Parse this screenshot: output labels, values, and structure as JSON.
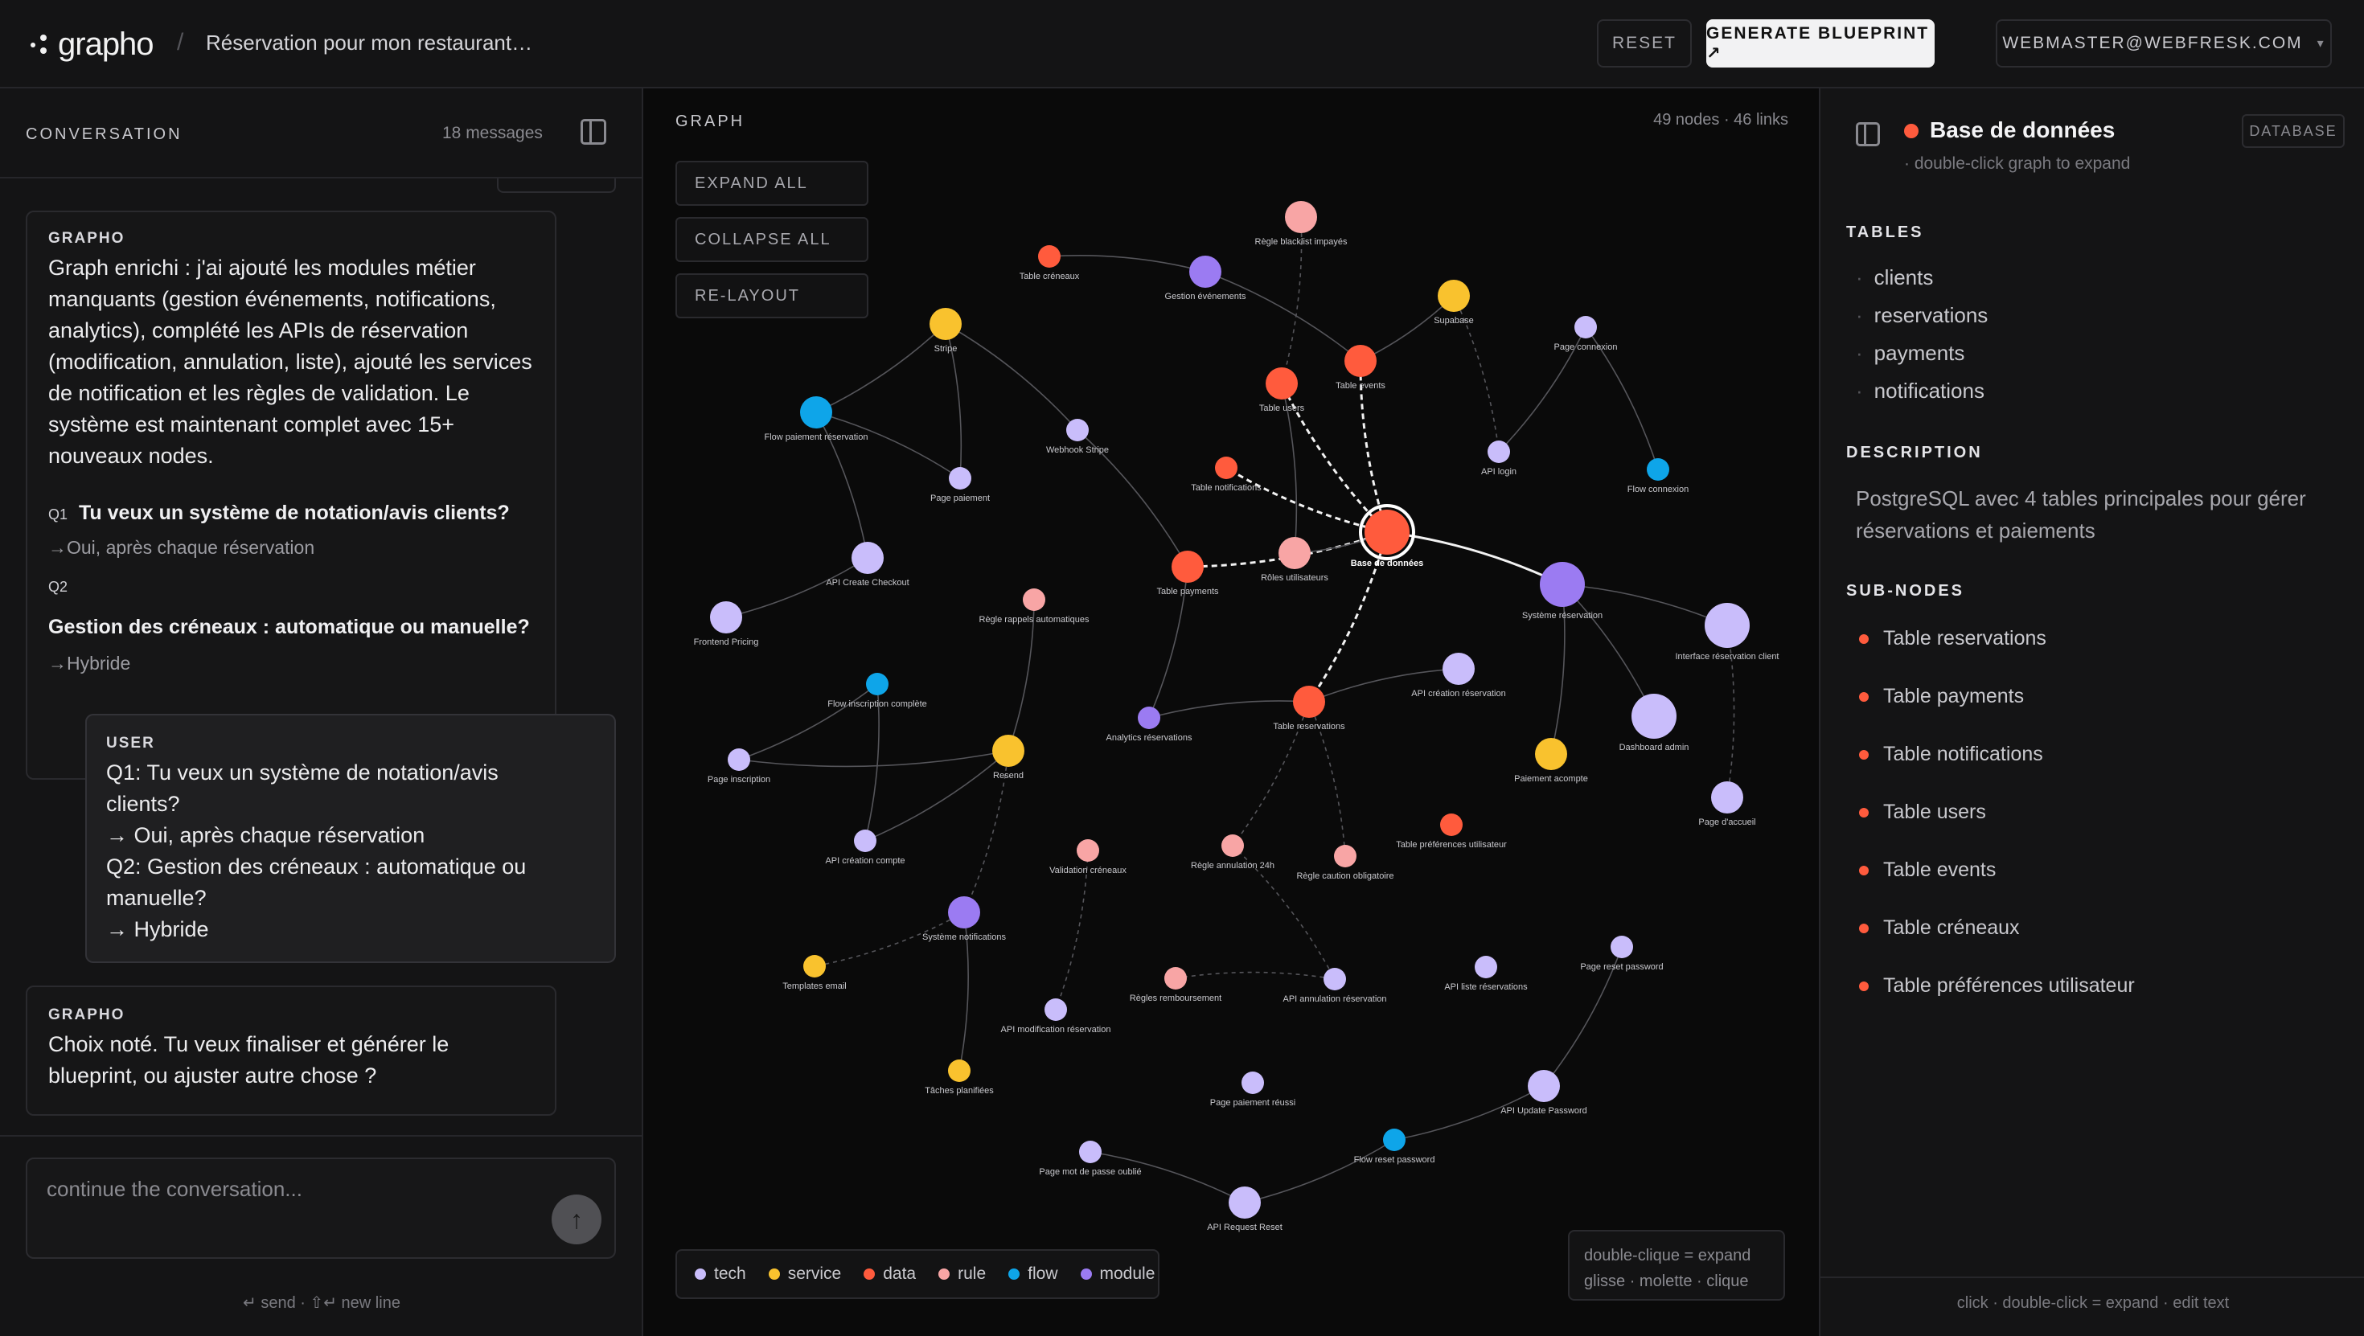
{
  "header": {
    "logo_text": "grapho",
    "crumb_separator": "/",
    "project_title": "Réservation pour mon restaurant…",
    "reset_label": "RESET",
    "generate_label": "GENERATE BLUEPRINT ↗",
    "user_email": "WEBMASTER@WEBFRESK.COM"
  },
  "conversation": {
    "title": "CONVERSATION",
    "count": "18 messages",
    "m1": {
      "author": "GRAPHO",
      "text": "Graph enrichi : j'ai ajouté les modules métier manquants (gestion événements, notifications, analytics), complété les APIs de réservation (modification, annulation, liste), ajouté les services de notification et les règles de validation. Le système est maintenant complet avec 15+ nouveaux nodes.",
      "q1_label": "Q1",
      "q1": "Tu veux un système de notation/avis clients?",
      "a1": "→Oui, après chaque réservation",
      "q2_label": "Q2",
      "q2": "Gestion des créneaux : automatique ou manuelle?",
      "a2": "→Hybride"
    },
    "m2": {
      "author": "USER",
      "l1": "Q1: Tu veux un système de notation/avis",
      "l2": "clients?",
      "l3": "→ Oui, après chaque réservation",
      "l4": "Q2: Gestion des créneaux : automatique ou",
      "l5": "manuelle?",
      "l6": "→ Hybride"
    },
    "m3": {
      "author": "GRAPHO",
      "text": "Choix noté. Tu veux finaliser et générer le blueprint, ou ajuster autre chose ?"
    },
    "input_placeholder": "continue the conversation...",
    "send_icon": "↑",
    "hint": "↵ send · ⇧↵ new line"
  },
  "graph": {
    "title": "GRAPH",
    "stats": "49 nodes · 46 links",
    "expand_all": "EXPAND ALL",
    "collapse_all": "COLLAPSE ALL",
    "relayout": "RE-LAYOUT",
    "hint_line1": "double-clique = expand",
    "hint_line2": "glisse · molette · clique",
    "legend": [
      {
        "label": "tech",
        "color": "#c9bdfb"
      },
      {
        "label": "service",
        "color": "#f9c22e"
      },
      {
        "label": "data",
        "color": "#ff5b3d"
      },
      {
        "label": "rule",
        "color": "#f8a5a5"
      },
      {
        "label": "flow",
        "color": "#0ea5e9"
      },
      {
        "label": "module",
        "color": "#9b7bf2"
      }
    ],
    "nodes": [
      {
        "id": "db",
        "label": "Base de données",
        "type": "data",
        "size": "lg",
        "selected": true
      },
      {
        "id": "systeme",
        "label": "Système réservation",
        "type": "module",
        "size": "lg"
      },
      {
        "id": "tresv",
        "label": "Table reservations",
        "type": "data",
        "size": "md"
      },
      {
        "id": "tpay",
        "label": "Table payments",
        "type": "data",
        "size": "md"
      },
      {
        "id": "tnotif",
        "label": "Table notifications",
        "type": "data",
        "size": "sm"
      },
      {
        "id": "tusers",
        "label": "Table users",
        "type": "data",
        "size": "md"
      },
      {
        "id": "tevents",
        "label": "Table events",
        "type": "data",
        "size": "md"
      },
      {
        "id": "tcren",
        "label": "Table créneaux",
        "type": "data",
        "size": "sm"
      },
      {
        "id": "tpref",
        "label": "Table préférences utilisateur",
        "type": "data",
        "size": "sm"
      },
      {
        "id": "roles",
        "label": "Rôles utilisateurs",
        "type": "rule",
        "size": "md"
      },
      {
        "id": "blacklist",
        "label": "Règle blacklist impayés",
        "type": "rule",
        "size": "md"
      },
      {
        "id": "gestev",
        "label": "Gestion événements",
        "type": "module",
        "size": "md"
      },
      {
        "id": "supabase",
        "label": "Supabase",
        "type": "service",
        "size": "md"
      },
      {
        "id": "stripe",
        "label": "Stripe",
        "type": "service",
        "size": "md"
      },
      {
        "id": "flowpay",
        "label": "Flow paiement réservation",
        "type": "flow",
        "size": "md"
      },
      {
        "id": "pagepay",
        "label": "Page paiement",
        "type": "tech",
        "size": "sm"
      },
      {
        "id": "webhook",
        "label": "Webhook Stripe",
        "type": "tech",
        "size": "sm"
      },
      {
        "id": "pageconn",
        "label": "Page connexion",
        "type": "tech",
        "size": "sm"
      },
      {
        "id": "apilogin",
        "label": "API login",
        "type": "tech",
        "size": "sm"
      },
      {
        "id": "flowconn",
        "label": "Flow connexion",
        "type": "flow",
        "size": "sm"
      },
      {
        "id": "apicheckout",
        "label": "API Create Checkout",
        "type": "tech",
        "size": "md"
      },
      {
        "id": "frontpricing",
        "label": "Frontend Pricing",
        "type": "tech",
        "size": "md"
      },
      {
        "id": "rappels",
        "label": "Règle rappels automatiques",
        "type": "rule",
        "size": "sm"
      },
      {
        "id": "flowinscr",
        "label": "Flow inscription complète",
        "type": "flow",
        "size": "sm"
      },
      {
        "id": "pageinscr",
        "label": "Page inscription",
        "type": "tech",
        "size": "sm"
      },
      {
        "id": "resend",
        "label": "Resend",
        "type": "service",
        "size": "md"
      },
      {
        "id": "apicompte",
        "label": "API création compte",
        "type": "tech",
        "size": "sm"
      },
      {
        "id": "analytics",
        "label": "Analytics réservations",
        "type": "module",
        "size": "sm"
      },
      {
        "id": "apicreres",
        "label": "API création réservation",
        "type": "tech",
        "size": "md"
      },
      {
        "id": "interface",
        "label": "Interface réservation client",
        "type": "tech",
        "size": "lg"
      },
      {
        "id": "dashboard",
        "label": "Dashboard admin",
        "type": "tech",
        "size": "lg"
      },
      {
        "id": "acompte",
        "label": "Paiement acompte",
        "type": "service",
        "size": "md"
      },
      {
        "id": "accueil",
        "label": "Page d'accueil",
        "type": "tech",
        "size": "md"
      },
      {
        "id": "validcren",
        "label": "Validation créneaux",
        "type": "rule",
        "size": "sm"
      },
      {
        "id": "annul24",
        "label": "Règle annulation 24h",
        "type": "rule",
        "size": "sm"
      },
      {
        "id": "caution",
        "label": "Règle caution obligatoire",
        "type": "rule",
        "size": "sm"
      },
      {
        "id": "sysnotif",
        "label": "Système notifications",
        "type": "module",
        "size": "md"
      },
      {
        "id": "templates",
        "label": "Templates email",
        "type": "service",
        "size": "sm"
      },
      {
        "id": "taches",
        "label": "Tâches planifiées",
        "type": "service",
        "size": "sm"
      },
      {
        "id": "apimodif",
        "label": "API modification réservation",
        "type": "tech",
        "size": "sm"
      },
      {
        "id": "rembours",
        "label": "Règles remboursement",
        "type": "rule",
        "size": "sm"
      },
      {
        "id": "apiannul",
        "label": "API annulation réservation",
        "type": "tech",
        "size": "sm"
      },
      {
        "id": "apiliste",
        "label": "API liste réservations",
        "type": "tech",
        "size": "sm"
      },
      {
        "id": "pagereset",
        "label": "Page reset password",
        "type": "tech",
        "size": "sm"
      },
      {
        "id": "apiupdate",
        "label": "API Update Password",
        "type": "tech",
        "size": "md"
      },
      {
        "id": "pagereussi",
        "label": "Page paiement réussi",
        "type": "tech",
        "size": "sm"
      },
      {
        "id": "flowreset",
        "label": "Flow reset password",
        "type": "flow",
        "size": "sm"
      },
      {
        "id": "pagemdp",
        "label": "Page mot de passe oublié",
        "type": "tech",
        "size": "sm"
      },
      {
        "id": "apireqreset",
        "label": "API Request Reset",
        "type": "tech",
        "size": "md"
      }
    ],
    "links": [
      {
        "s": "db",
        "t": "systeme",
        "style": "solid-bold"
      },
      {
        "s": "db",
        "t": "tresv",
        "style": "dash-bold"
      },
      {
        "s": "db",
        "t": "tpay",
        "style": "dash-bold"
      },
      {
        "s": "db",
        "t": "tnotif",
        "style": "dash-bold"
      },
      {
        "s": "db",
        "t": "tusers",
        "style": "dash-bold"
      },
      {
        "s": "db",
        "t": "tevents",
        "style": "dash-bold"
      },
      {
        "s": "db",
        "t": "roles",
        "style": "solid"
      },
      {
        "s": "systeme",
        "t": "interface",
        "style": "solid"
      },
      {
        "s": "systeme",
        "t": "dashboard",
        "style": "solid"
      },
      {
        "s": "systeme",
        "t": "acompte",
        "style": "solid"
      },
      {
        "s": "interface",
        "t": "accueil",
        "style": "dash"
      },
      {
        "s": "tcren",
        "t": "gestev",
        "style": "solid"
      },
      {
        "s": "gestev",
        "t": "tevents",
        "style": "solid"
      },
      {
        "s": "supabase",
        "t": "tevents",
        "style": "solid"
      },
      {
        "s": "supabase",
        "t": "apilogin",
        "style": "dash"
      },
      {
        "s": "pageconn",
        "t": "apilogin",
        "style": "solid"
      },
      {
        "s": "pageconn",
        "t": "flowconn",
        "style": "solid"
      },
      {
        "s": "blacklist",
        "t": "tusers",
        "style": "dash"
      },
      {
        "s": "stripe",
        "t": "flowpay",
        "style": "solid"
      },
      {
        "s": "stripe",
        "t": "pagepay",
        "style": "solid"
      },
      {
        "s": "stripe",
        "t": "webhook",
        "style": "solid"
      },
      {
        "s": "flowpay",
        "t": "pagepay",
        "style": "solid"
      },
      {
        "s": "flowpay",
        "t": "apicheckout",
        "style": "solid"
      },
      {
        "s": "webhook",
        "t": "tpay",
        "style": "solid"
      },
      {
        "s": "apicheckout",
        "t": "frontpricing",
        "style": "solid"
      },
      {
        "s": "tpay",
        "t": "analytics",
        "style": "solid"
      },
      {
        "s": "analytics",
        "t": "tresv",
        "style": "solid"
      },
      {
        "s": "tresv",
        "t": "apicreres",
        "style": "solid"
      },
      {
        "s": "tresv",
        "t": "annul24",
        "style": "dash"
      },
      {
        "s": "tresv",
        "t": "caution",
        "style": "dash"
      },
      {
        "s": "rappels",
        "t": "resend",
        "style": "solid"
      },
      {
        "s": "resend",
        "t": "pageinscr",
        "style": "solid"
      },
      {
        "s": "resend",
        "t": "apicompte",
        "style": "solid"
      },
      {
        "s": "resend",
        "t": "sysnotif",
        "style": "dash"
      },
      {
        "s": "flowinscr",
        "t": "pageinscr",
        "style": "solid"
      },
      {
        "s": "flowinscr",
        "t": "apicompte",
        "style": "solid"
      },
      {
        "s": "sysnotif",
        "t": "templates",
        "style": "dash"
      },
      {
        "s": "sysnotif",
        "t": "taches",
        "style": "solid"
      },
      {
        "s": "validcren",
        "t": "apimodif",
        "style": "dash"
      },
      {
        "s": "annul24",
        "t": "apiannul",
        "style": "dash"
      },
      {
        "s": "rembours",
        "t": "apiannul",
        "style": "dash"
      },
      {
        "s": "pagereset",
        "t": "apiupdate",
        "style": "solid"
      },
      {
        "s": "apiupdate",
        "t": "flowreset",
        "style": "solid"
      },
      {
        "s": "flowreset",
        "t": "apireqreset",
        "style": "solid"
      },
      {
        "s": "pagemdp",
        "t": "apireqreset",
        "style": "solid"
      },
      {
        "s": "tusers",
        "t": "roles",
        "style": "solid"
      }
    ]
  },
  "inspector": {
    "title": "Base de données",
    "badge": "DATABASE",
    "subtitle": "· double-click graph to expand",
    "tables_heading": "TABLES",
    "tables": [
      "clients",
      "reservations",
      "payments",
      "notifications"
    ],
    "description_heading": "DESCRIPTION",
    "description": "PostgreSQL avec 4 tables principales pour gérer réservations et paiements",
    "subnodes_heading": "SUB-NODES",
    "subnodes": [
      "Table reservations",
      "Table payments",
      "Table notifications",
      "Table users",
      "Table events",
      "Table créneaux",
      "Table préférences utilisateur"
    ],
    "footer": "click · double-click = expand · edit text"
  }
}
